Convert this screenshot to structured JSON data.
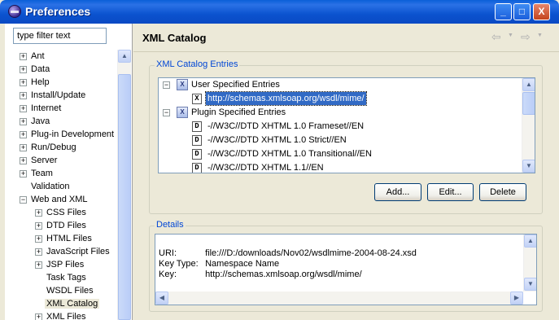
{
  "window": {
    "title": "Preferences",
    "controls": {
      "minimize": "_",
      "maximize": "□",
      "close": "X"
    }
  },
  "sidebar": {
    "filter_value": "type filter text",
    "items": [
      {
        "label": "Ant",
        "expander": "+"
      },
      {
        "label": "Data",
        "expander": "+"
      },
      {
        "label": "Help",
        "expander": "+"
      },
      {
        "label": "Install/Update",
        "expander": "+"
      },
      {
        "label": "Internet",
        "expander": "+"
      },
      {
        "label": "Java",
        "expander": "+"
      },
      {
        "label": "Plug-in Development",
        "expander": "+"
      },
      {
        "label": "Run/Debug",
        "expander": "+"
      },
      {
        "label": "Server",
        "expander": "+"
      },
      {
        "label": "Team",
        "expander": "+"
      },
      {
        "label": "Validation",
        "expander": ""
      },
      {
        "label": "Web and XML",
        "expander": "−"
      },
      {
        "label": "CSS Files",
        "expander": "+"
      },
      {
        "label": "DTD Files",
        "expander": "+"
      },
      {
        "label": "HTML Files",
        "expander": "+"
      },
      {
        "label": "JavaScript Files",
        "expander": "+"
      },
      {
        "label": "JSP Files",
        "expander": "+"
      },
      {
        "label": "Task Tags",
        "expander": ""
      },
      {
        "label": "WSDL Files",
        "expander": ""
      },
      {
        "label": "XML Catalog",
        "expander": ""
      },
      {
        "label": "XML Files",
        "expander": "+"
      }
    ]
  },
  "main": {
    "page_title": "XML Catalog",
    "nav": {
      "back": "⇦",
      "forward": "⇨",
      "dropdown": "▼"
    },
    "entries_group": {
      "label": "XML Catalog Entries",
      "rows": [
        {
          "expander": "−",
          "icon": "X",
          "label": "User Specified Entries"
        },
        {
          "expander": "",
          "icon": "X",
          "label": "http://schemas.xmlsoap.org/wsdl/mime/"
        },
        {
          "expander": "−",
          "icon": "X",
          "label": "Plugin Specified Entries"
        },
        {
          "expander": "",
          "icon": "D",
          "label": "-//W3C//DTD XHTML 1.0 Frameset//EN"
        },
        {
          "expander": "",
          "icon": "D",
          "label": "-//W3C//DTD XHTML 1.0 Strict//EN"
        },
        {
          "expander": "",
          "icon": "D",
          "label": "-//W3C//DTD XHTML 1.0 Transitional//EN"
        },
        {
          "expander": "",
          "icon": "D",
          "label": "-//W3C//DTD XHTML 1.1//EN"
        }
      ],
      "buttons": {
        "add": "Add...",
        "edit": "Edit...",
        "delete": "Delete"
      }
    },
    "details": {
      "label": "Details",
      "uri_key": "URI:",
      "uri_value": "file:///D:/downloads/Nov02/wsdlmime-2004-08-24.xsd",
      "keytype_key": "Key Type:",
      "keytype_value": "Namespace Name",
      "key_key": "Key:",
      "key_value": "http://schemas.xmlsoap.org/wsdl/mime/"
    }
  },
  "scroll_glyphs": {
    "up": "▲",
    "down": "▼",
    "left": "◀",
    "right": "▶"
  }
}
